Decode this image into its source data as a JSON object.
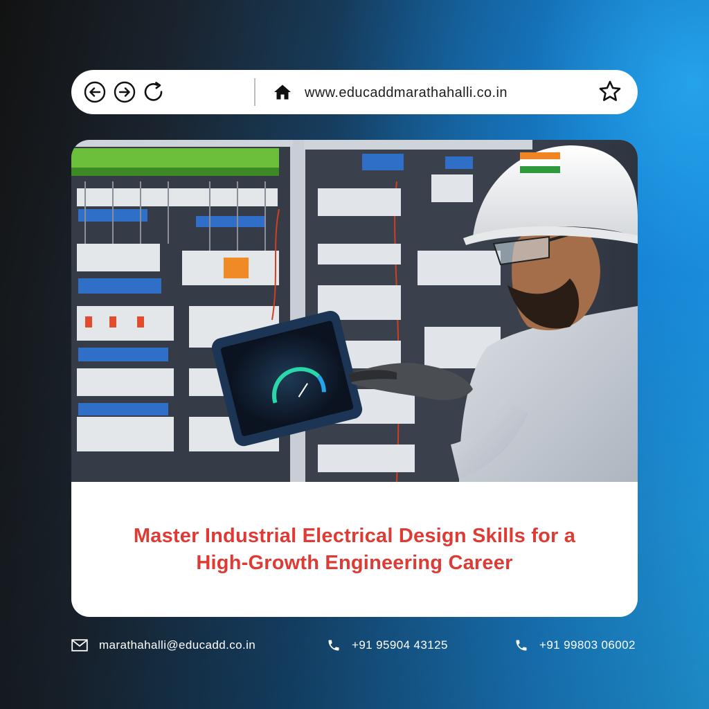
{
  "browser": {
    "url": "www.educaddmarathahalli.co.in",
    "icons": [
      "back-arrow-icon",
      "forward-arrow-icon",
      "reload-icon",
      "home-icon",
      "bookmark-star-icon"
    ]
  },
  "card": {
    "image": "industrial-electrical-engineer-photo",
    "headline_line1": "Master Industrial Electrical Design Skills for a",
    "headline_line2": "High-Growth Engineering Career"
  },
  "contacts": {
    "email": "marathahalli@educadd.co.in",
    "phone1": "+91 95904 43125",
    "phone2": "+91 99803 06002",
    "icons": [
      "mail-icon",
      "phone-icon"
    ]
  },
  "colors": {
    "headline": "#de3b35",
    "background_left": "#131313",
    "background_right": "#22a6ee"
  }
}
